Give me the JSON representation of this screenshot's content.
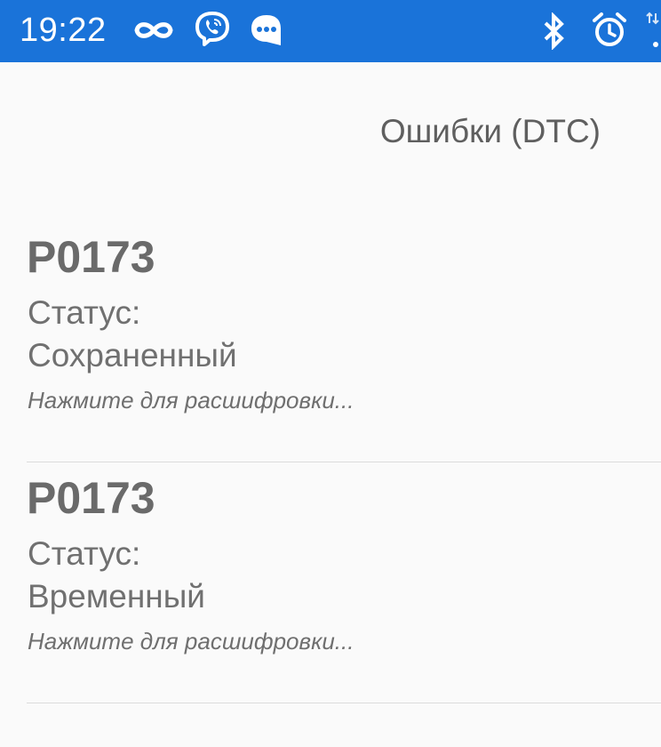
{
  "status_bar": {
    "time": "19:22",
    "left_icons": [
      "infinity-icon",
      "viber-icon",
      "chat-bubble-icon"
    ],
    "right_icons": [
      "bluetooth-icon",
      "alarm-clock-icon",
      "data-arrows-icon"
    ],
    "background_color": "#1a73d9"
  },
  "page": {
    "title": "Ошибки (DTC)"
  },
  "dtc_list": [
    {
      "code": "P0173",
      "status_label": "Статус:",
      "status_value": "Сохраненный",
      "hint": "Нажмите для расшифровки..."
    },
    {
      "code": "P0173",
      "status_label": "Статус:",
      "status_value": "Временный",
      "hint": "Нажмите для расшифровки..."
    }
  ]
}
